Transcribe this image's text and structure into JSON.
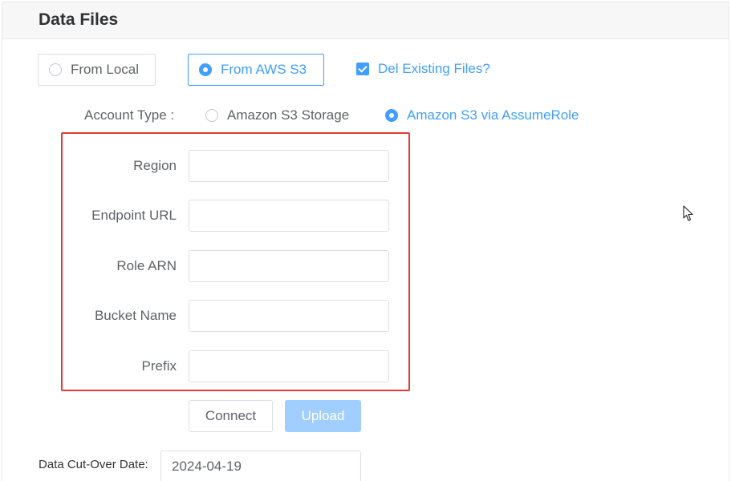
{
  "panel": {
    "title": "Data Files"
  },
  "source": {
    "options": [
      {
        "label": "From Local",
        "selected": false
      },
      {
        "label": "From AWS S3",
        "selected": true
      }
    ],
    "delete_existing": {
      "label": "Del Existing Files?",
      "checked": true
    }
  },
  "account_type": {
    "label": "Account Type :",
    "options": [
      {
        "label": "Amazon S3 Storage",
        "selected": false
      },
      {
        "label": "Amazon S3 via AssumeRole",
        "selected": true
      }
    ]
  },
  "form": {
    "fields": [
      {
        "label": "Region",
        "value": ""
      },
      {
        "label": "Endpoint URL",
        "value": ""
      },
      {
        "label": "Role ARN",
        "value": ""
      },
      {
        "label": "Bucket Name",
        "value": ""
      },
      {
        "label": "Prefix",
        "value": ""
      }
    ]
  },
  "actions": {
    "connect_label": "Connect",
    "upload_label": "Upload"
  },
  "cutover": {
    "label": "Data Cut-Over Date:",
    "value": "2024-04-19"
  },
  "colors": {
    "accent": "#409eff",
    "highlight_border": "#e53935",
    "disabled_button": "#a0cfff"
  }
}
